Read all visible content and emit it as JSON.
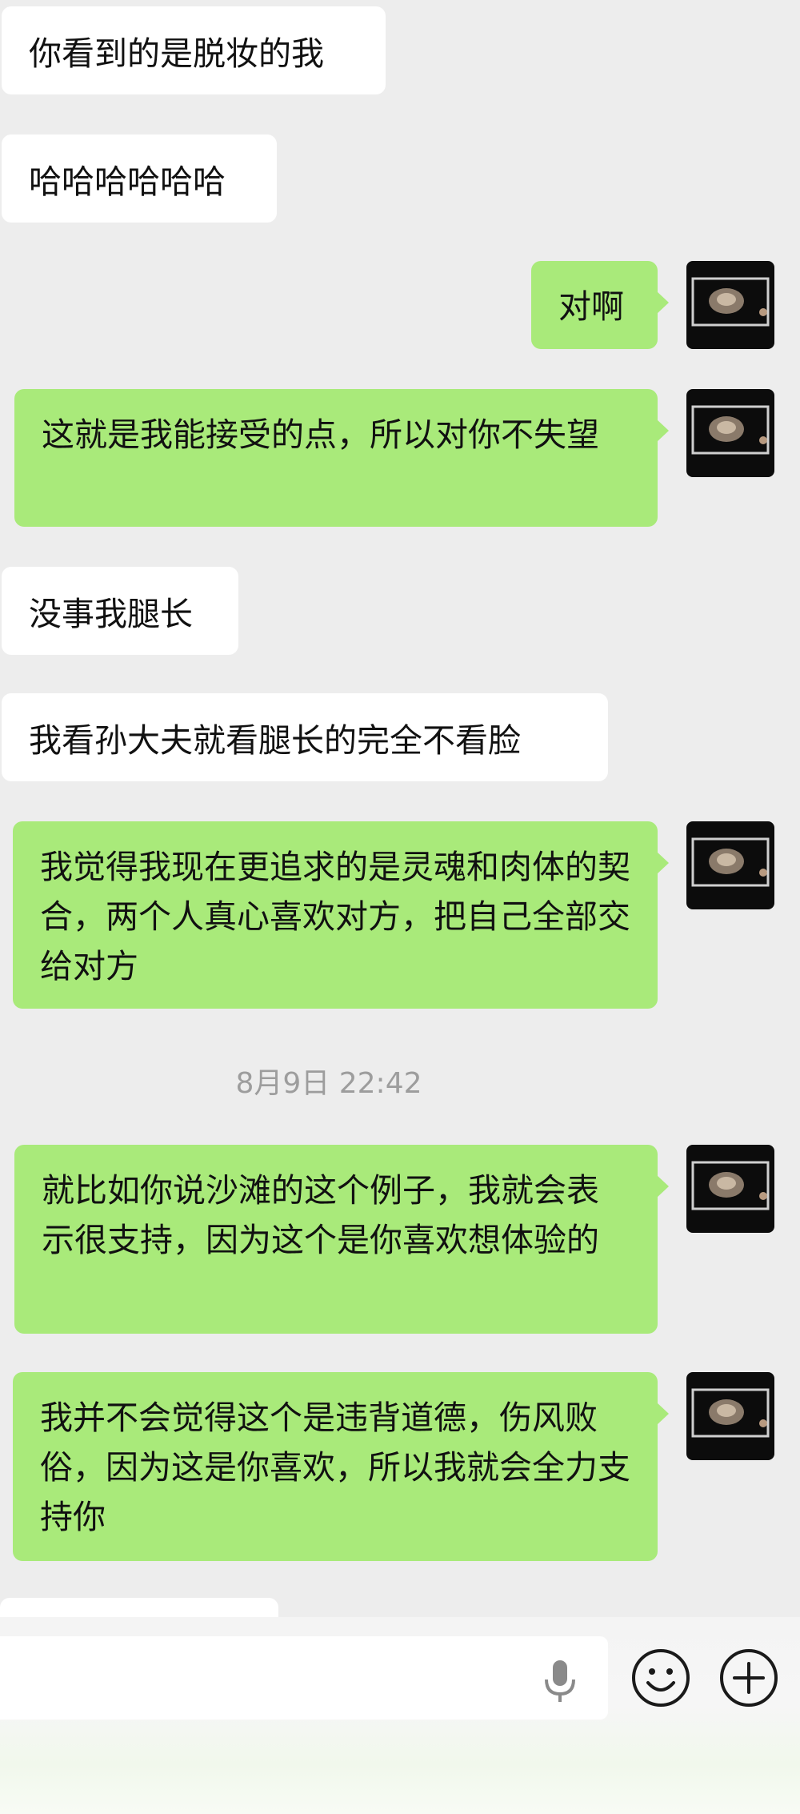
{
  "messages": [
    {
      "side": "in",
      "text": "你看到的是脱妆的我"
    },
    {
      "side": "in",
      "text": "哈哈哈哈哈哈"
    },
    {
      "side": "out",
      "text": "对啊"
    },
    {
      "side": "out",
      "text": "这就是我能接受的点，所以对你不失望"
    },
    {
      "side": "in",
      "text": "没事我腿长"
    },
    {
      "side": "in",
      "text": "我看孙大夫就看腿长的完全不看脸"
    },
    {
      "side": "out",
      "text": "我觉得我现在更追求的是灵魂和肉体的契合，两个人真心喜欢对方，把自己全部交给对方"
    },
    {
      "side": "out",
      "text": "就比如你说沙滩的这个例子，我就会表示很支持，因为这个是你喜欢想体验的"
    },
    {
      "side": "out",
      "text": "我并不会觉得这个是违背道德，伤风败俗，因为这是你喜欢，所以我就会全力支持你"
    }
  ],
  "timestamp": "8月9日 22:42",
  "input_bar": {
    "voice_icon": "microphone-icon",
    "emoji_icon": "smiley-face-icon",
    "more_icon": "plus-circle-icon"
  },
  "colors": {
    "chat_bg": "#ededed",
    "incoming_bubble": "#ffffff",
    "outgoing_bubble": "#a9ea7a",
    "timestamp_text": "#9d9d9d"
  }
}
